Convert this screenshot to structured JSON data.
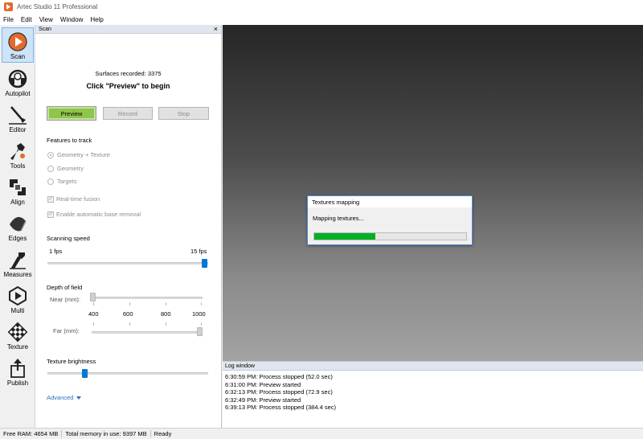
{
  "window": {
    "title": "Artec Studio 11 Professional"
  },
  "menu": [
    "File",
    "Edit",
    "View",
    "Window",
    "Help"
  ],
  "toolbar": {
    "items": [
      {
        "label": "Scan",
        "icon": "scan-icon",
        "active": true
      },
      {
        "label": "Autopilot",
        "icon": "autopilot-icon",
        "active": false
      },
      {
        "label": "Editor",
        "icon": "editor-icon",
        "active": false
      },
      {
        "label": "Tools",
        "icon": "tools-icon",
        "active": false
      },
      {
        "label": "Align",
        "icon": "align-icon",
        "active": false
      },
      {
        "label": "Edges",
        "icon": "edges-icon",
        "active": false
      },
      {
        "label": "Measures",
        "icon": "measures-icon",
        "active": false
      },
      {
        "label": "Multi",
        "icon": "multi-icon",
        "active": false
      },
      {
        "label": "Texture",
        "icon": "texture-icon",
        "active": false
      },
      {
        "label": "Publish",
        "icon": "publish-icon",
        "active": false
      }
    ]
  },
  "scan_panel": {
    "header": "Scan",
    "surfaces_recorded": "Surfaces recorded: 3375",
    "prompt": "Click \"Preview\" to begin",
    "buttons": {
      "preview": "Preview",
      "record": "Record",
      "stop": "Stop"
    },
    "features_title": "Features to track",
    "features": [
      "Geometry + Texture",
      "Geometry",
      "Targets"
    ],
    "features_selected": "Geometry + Texture",
    "realtime_fusion": "Real-time fusion",
    "realtime_fusion_checked": true,
    "auto_base_removal": "Enable automatic base removal",
    "auto_base_removal_checked": true,
    "scanning_speed": {
      "title": "Scanning speed",
      "min_label": "1 fps",
      "max_label": "15 fps",
      "value": 15
    },
    "depth_of_field": {
      "title": "Depth of field",
      "near_label": "Near (mm):",
      "far_label": "Far (mm):",
      "ticks": [
        "400",
        "600",
        "800",
        "1000"
      ]
    },
    "texture_brightness": {
      "title": "Texture brightness",
      "value_fraction": 0.24
    },
    "advanced": "Advanced"
  },
  "dialog": {
    "title": "Textures mapping",
    "message": "Mapping textures...",
    "progress_percent": 40,
    "progress_color": "#06b025"
  },
  "log": {
    "title": "Log window",
    "lines": [
      "6:30:59 PM: Process stopped (52.0 sec)",
      "6:31:00 PM: Preview started",
      "6:32:13 PM: Process stopped (72.9 sec)",
      "6:32:49 PM: Preview started",
      "6:39:13 PM: Process stopped (384.4 sec)"
    ]
  },
  "status": {
    "free_ram": "Free RAM: 4654 MB",
    "total_memory": "Total memory in use: 9397 MB",
    "state": "Ready"
  },
  "colors": {
    "accent": "#0078d7",
    "preview_button": "#8ec64b",
    "advanced_link": "#2a6fc4"
  }
}
